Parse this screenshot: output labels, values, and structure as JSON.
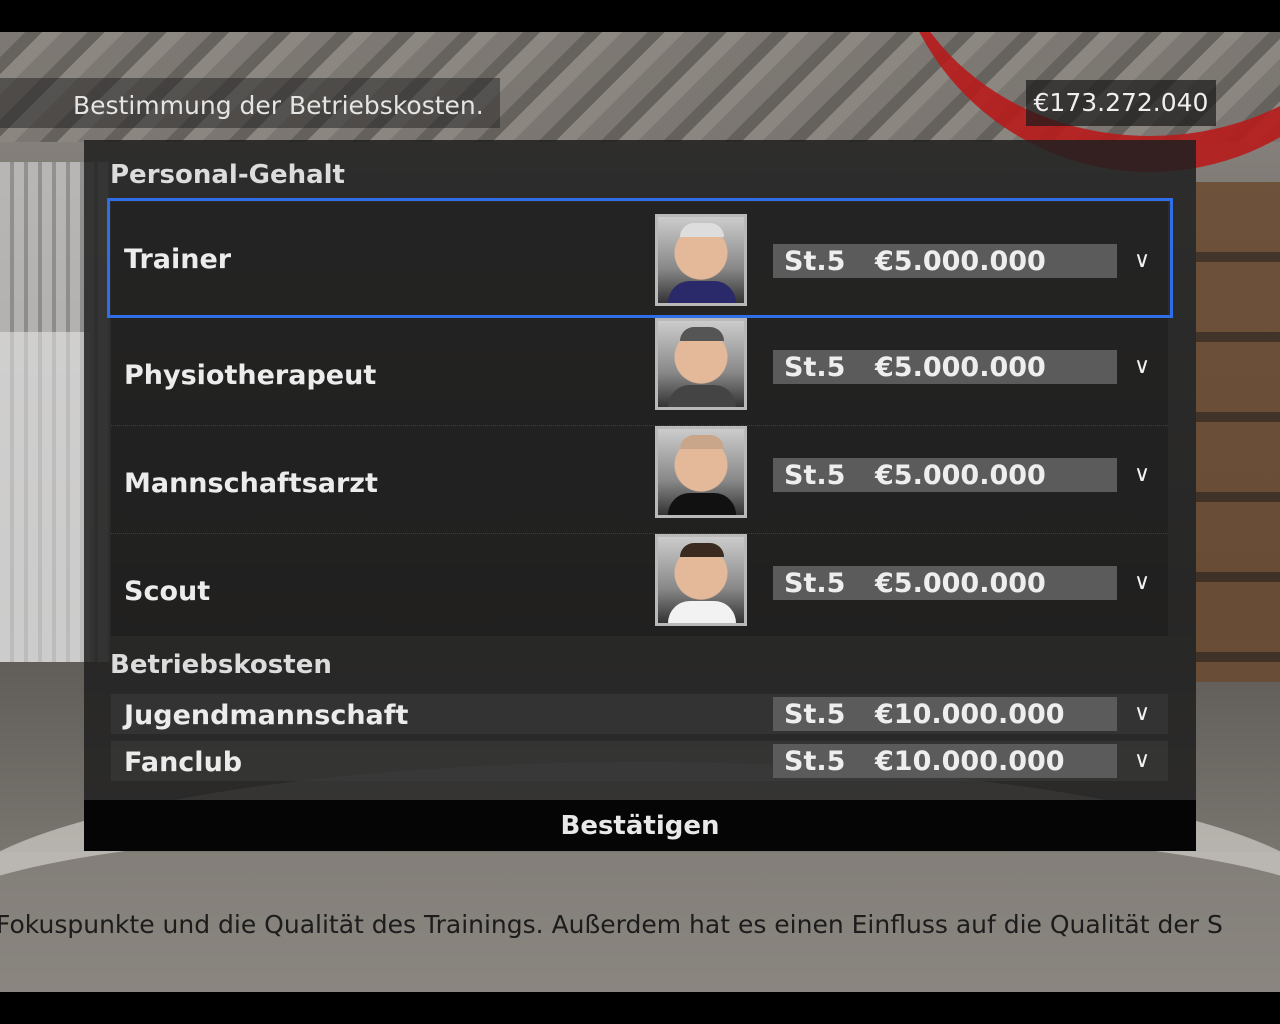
{
  "header": {
    "title": "Bestimmung der Betriebskosten.",
    "balance": "€173.272.040"
  },
  "staff_section": {
    "title": "Personal-Gehalt",
    "rows": [
      {
        "label": "Trainer",
        "level": "St.5",
        "amount": "€5.000.000",
        "selected": true
      },
      {
        "label": "Physiotherapeut",
        "level": "St.5",
        "amount": "€5.000.000",
        "selected": false
      },
      {
        "label": "Mannschaftsarzt",
        "level": "St.5",
        "amount": "€5.000.000",
        "selected": false
      },
      {
        "label": "Scout",
        "level": "St.5",
        "amount": "€5.000.000",
        "selected": false
      }
    ]
  },
  "costs_section": {
    "title": "Betriebskosten",
    "rows": [
      {
        "label": "Jugendmannschaft",
        "level": "St.5",
        "amount": "€10.000.000"
      },
      {
        "label": "Fanclub",
        "level": "St.5",
        "amount": "€10.000.000"
      }
    ]
  },
  "confirm_label": "Bestätigen",
  "ticker_text": "Fokuspunkte und die Qualität des Trainings. Außerdem hat es einen Einfluss auf die Qualität der S",
  "icons": {
    "dropdown": "chevron-down-icon",
    "selection_color": "#2f6ee6"
  }
}
